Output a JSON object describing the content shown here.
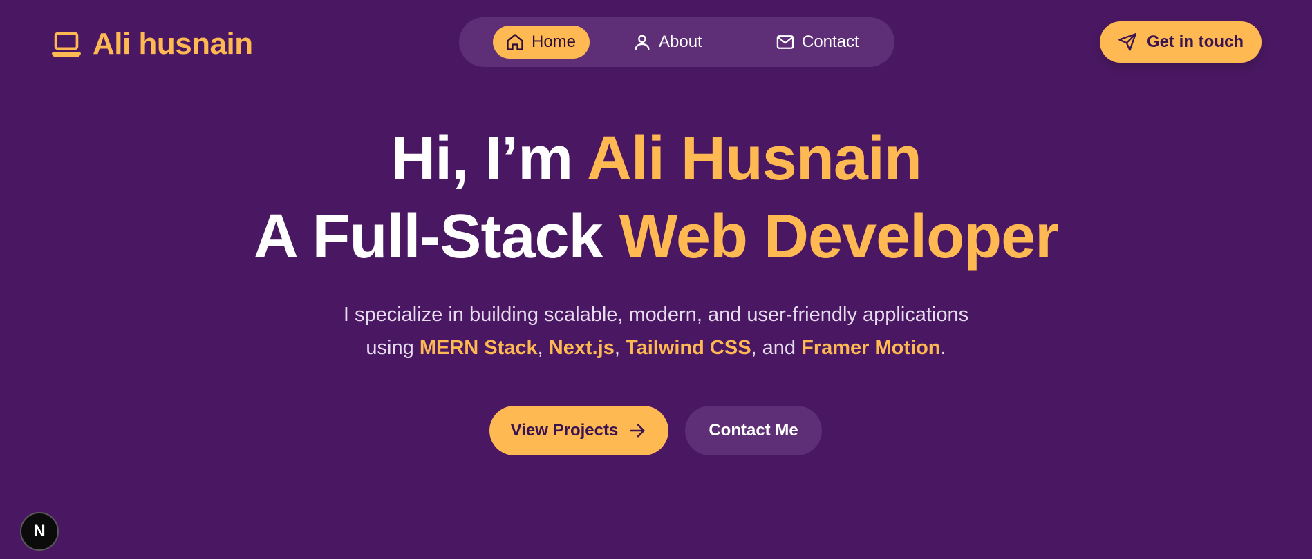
{
  "brand": {
    "name": "Ali husnain",
    "icon": "laptop-icon"
  },
  "nav": {
    "items": [
      {
        "label": "Home",
        "icon": "home-icon",
        "active": true
      },
      {
        "label": "About",
        "icon": "user-icon",
        "active": false
      },
      {
        "label": "Contact",
        "icon": "mail-icon",
        "active": false
      }
    ]
  },
  "header_cta": {
    "label": "Get in touch",
    "icon": "send-icon"
  },
  "hero": {
    "line1_plain": "Hi, I’m ",
    "line1_accent": "Ali Husnain",
    "line2_plain": "A Full-Stack ",
    "line2_accent": "Web Developer",
    "sub_line1": "I specialize in building scalable, modern, and user-friendly applications",
    "sub_using": "using ",
    "tech": [
      "MERN Stack",
      "Next.js",
      "Tailwind CSS",
      "Framer Motion"
    ],
    "sep_comma": ", ",
    "sep_and": ", and ",
    "sub_end": "."
  },
  "buttons": {
    "primary_label": "View Projects",
    "primary_icon": "arrow-right-icon",
    "secondary_label": "Contact Me"
  },
  "dev_badge": {
    "letter": "N"
  },
  "colors": {
    "background": "#4a1862",
    "accent": "#ffb952",
    "pill": "#5e2e77",
    "text": "#ffffff"
  }
}
